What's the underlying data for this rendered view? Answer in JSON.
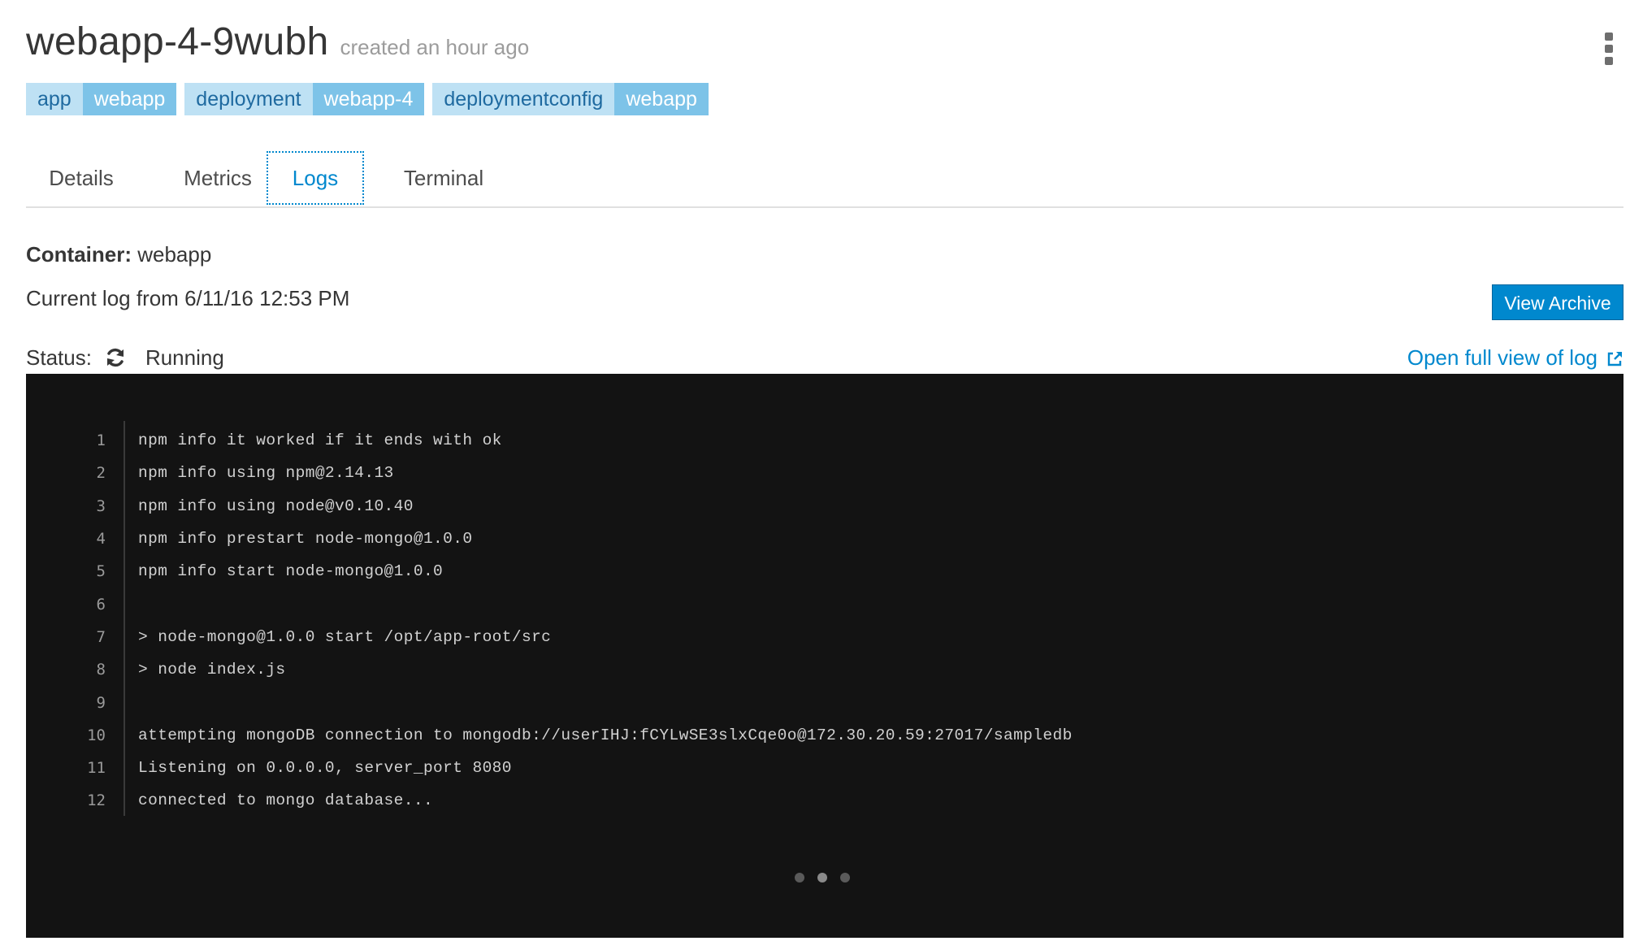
{
  "header": {
    "pod_name": "webapp-4-9wubh",
    "created": "created an hour ago"
  },
  "labels": [
    {
      "key": "app",
      "value": "webapp"
    },
    {
      "key": "deployment",
      "value": "webapp-4"
    },
    {
      "key": "deploymentconfig",
      "value": "webapp"
    }
  ],
  "tabs": [
    {
      "label": "Details",
      "active": false
    },
    {
      "label": "Metrics",
      "active": false
    },
    {
      "label": "Logs",
      "active": true
    },
    {
      "label": "Terminal",
      "active": false
    }
  ],
  "container": {
    "label": "Container:",
    "value": "webapp"
  },
  "log_from": "Current log from 6/11/16 12:53 PM",
  "view_archive_label": "View Archive",
  "status": {
    "label": "Status:",
    "icon": "refresh-icon",
    "value": "Running"
  },
  "open_full_label": "Open full view of log",
  "log_lines": [
    {
      "num": "1",
      "text": "npm info it worked if it ends with ok"
    },
    {
      "num": "2",
      "text": "npm info using npm@2.14.13"
    },
    {
      "num": "3",
      "text": "npm info using node@v0.10.40"
    },
    {
      "num": "4",
      "text": "npm info prestart node-mongo@1.0.0"
    },
    {
      "num": "5",
      "text": "npm info start node-mongo@1.0.0"
    },
    {
      "num": "6",
      "text": ""
    },
    {
      "num": "7",
      "text": "> node-mongo@1.0.0 start /opt/app-root/src"
    },
    {
      "num": "8",
      "text": "> node index.js"
    },
    {
      "num": "9",
      "text": ""
    },
    {
      "num": "10",
      "text": "attempting mongoDB connection to mongodb://userIHJ:fCYLwSE3slxCqe0o@172.30.20.59:27017/sampledb"
    },
    {
      "num": "11",
      "text": "Listening on 0.0.0.0, server_port 8080"
    },
    {
      "num": "12",
      "text": "connected to mongo database..."
    }
  ],
  "colors": {
    "accent": "#0088ce",
    "label_key_bg": "#bee1f4",
    "label_value_bg": "#7dc3e8",
    "log_bg": "#131313"
  }
}
